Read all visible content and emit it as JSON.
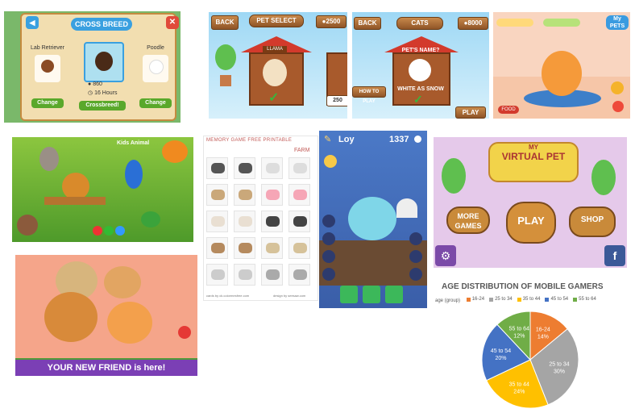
{
  "tiles": {
    "crossbreed": {
      "title": "CROSS BREED",
      "left_pet": "Lab Retriever",
      "right_pet": "Poodle",
      "cost": "860",
      "time": "16 Hours",
      "change_left": "Change",
      "change_right": "Change",
      "action": "Crossbreed!",
      "colors": {
        "bg": "#2f6fae",
        "panel": "#f7e6c0",
        "green": "#5aa82b",
        "red": "#e04a3a"
      }
    },
    "petselect": {
      "back": "BACK",
      "title": "PET SELECT",
      "coins": "2500",
      "name": "LLAMA",
      "coins_side": "250"
    },
    "cats": {
      "back": "BACK",
      "title": "CATS",
      "coins": "8000",
      "question": "PET'S NAME?",
      "how_to_play": "HOW TO PLAY",
      "name": "WHITE AS SNOW",
      "play": "PLAY"
    },
    "catroom": {
      "logo": "My PETS",
      "food": "FOOD"
    },
    "kids_animals": {
      "sign": "Kids Animal"
    },
    "memory": {
      "header_a": "MEMORY GAME  FREE  PRINTABLE",
      "header_b": "FARM",
      "footer_a": "cards by ck.colormesfree.com",
      "footer_b": "design by seesaw.com"
    },
    "loy": {
      "name": "Loy",
      "score": "1337"
    },
    "virtual_pet": {
      "logo_my": "MY",
      "logo_main": "VIRTUAL PET",
      "more_games": "MORE GAMES",
      "play": "PLAY",
      "shop": "SHOP",
      "fb": "f"
    },
    "new_friend": {
      "banner": "YOUR NEW FRIEND is here!"
    }
  },
  "chart_data": {
    "type": "pie",
    "title": "AGE DISTRIBUTION OF MOBILE GAMERS",
    "legend_title": "age (group)",
    "legend_position": "top",
    "categories": [
      "16-24",
      "25 to 34",
      "35 to 44",
      "45 to 54",
      "55 to 64"
    ],
    "values": [
      14,
      30,
      24,
      20,
      12
    ],
    "value_labels": [
      "14%",
      "30%",
      "24%",
      "20%",
      "12%"
    ],
    "colors": [
      "#ed7d31",
      "#a5a5a5",
      "#ffc000",
      "#4472c4",
      "#70ad47"
    ]
  }
}
